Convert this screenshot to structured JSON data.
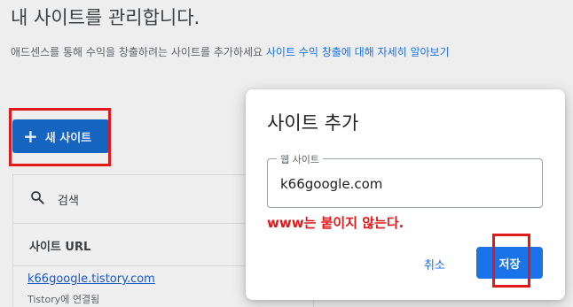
{
  "header": {
    "title": "내 사이트를 관리합니다.",
    "description": "애드센스를 통해 수익을 창출하려는 사이트를 추가하세요",
    "link": "사이트 수익 창출에 대해 자세히 알아보기"
  },
  "toolbar": {
    "new_site_label": "새 사이트",
    "new_site_icon": "+"
  },
  "site_table": {
    "search_label": "검색",
    "column_header": "사이트 URL",
    "rows": [
      {
        "url": "k66google.tistory.com",
        "status": "Tistory에 연결됨"
      }
    ]
  },
  "dialog": {
    "title": "사이트 추가",
    "field_label": "웹 사이트",
    "field_value": "k66google.com",
    "annotation": "www는 붙이지 않는다.",
    "cancel_label": "취소",
    "save_label": "저장"
  },
  "colors": {
    "accent": "#1a73e8",
    "annotation_red": "#e0191c"
  }
}
